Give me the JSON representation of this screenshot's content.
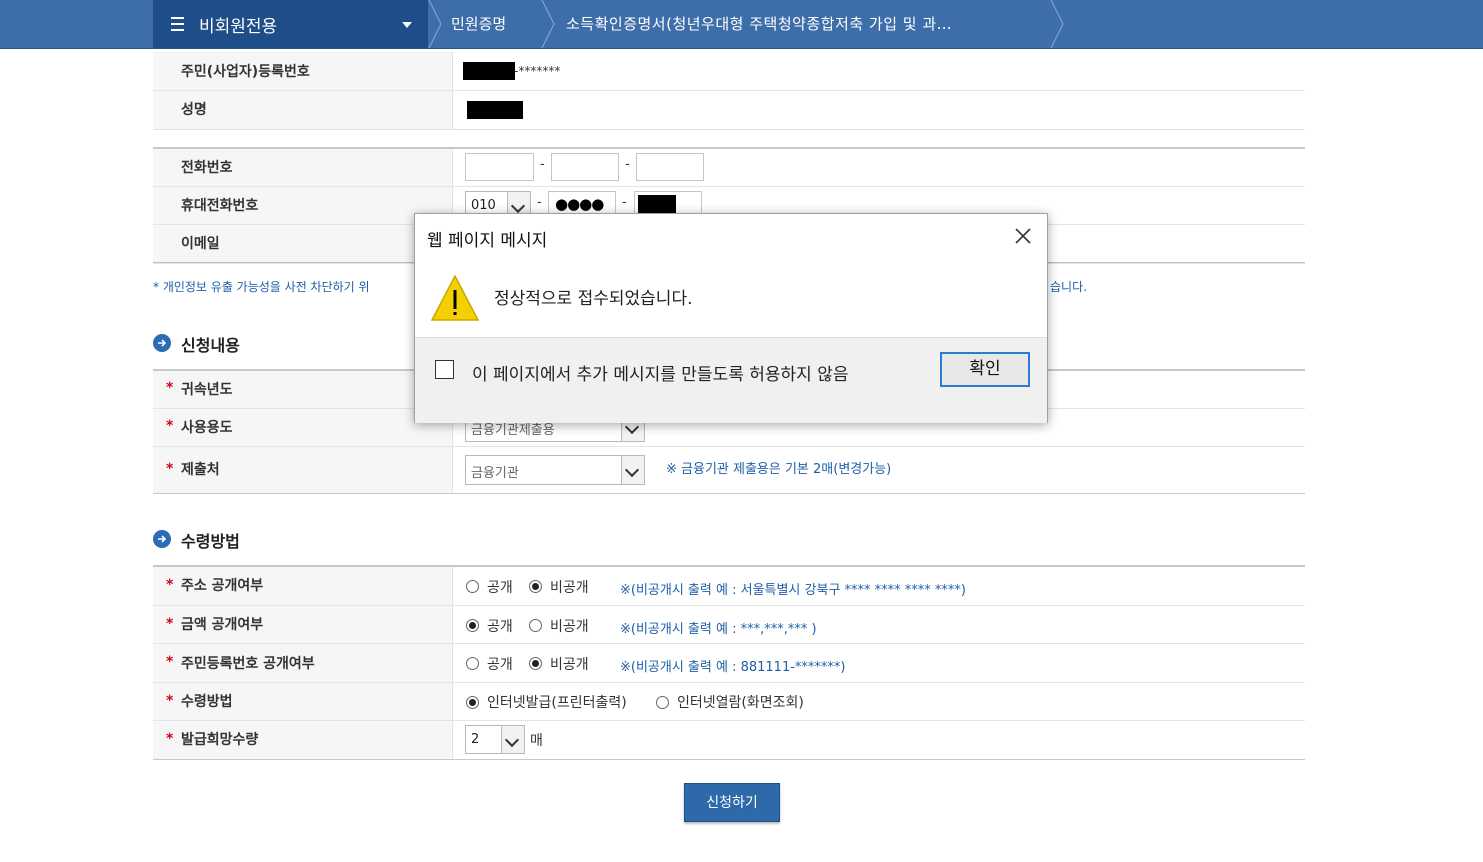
{
  "nav": {
    "menu_title": "비회원전용",
    "crumb1": "민원증명",
    "crumb2": "소득확인증명서(청년우대형 주택청약종합저축 가입 및 과…"
  },
  "personal": {
    "id_label": "주민(사업자)등록번호",
    "id_mask_suffix": "-*******",
    "name_label": "성명"
  },
  "contact": {
    "phone_label": "전화번호",
    "mobile_label": "휴대전화번호",
    "mobile_prefix": "010",
    "mobile_mid": "●●●●",
    "email_label": "이메일",
    "dash": "-",
    "notice_left": "* 개인정보 유출 가능성을 사전 차단하기 위",
    "notice_right": "습니다."
  },
  "apply": {
    "section_title": "신청내용",
    "year_label": "귀속년도",
    "usage_label": "사용용도",
    "usage_value": "금융기관제출용",
    "submit_to_label": "제출처",
    "submit_to_value": "금융기관",
    "submit_to_note": "※ 금융기관 제출용은 기본 2매(변경가능)"
  },
  "receive": {
    "section_title": "수령방법",
    "addr_label": "주소 공개여부",
    "amount_label": "금액 공개여부",
    "rrn_label": "주민등록번호 공개여부",
    "method_label": "수령방법",
    "qty_label": "발급희망수량",
    "public": "공개",
    "private": "비공개",
    "addr_note": "※(비공개시 출력 예 : 서울특별시 강북구 **** **** **** ****)",
    "amount_note": "※(비공개시 출력 예 : ***,***,*** )",
    "rrn_note": "※(비공개시 출력 예 : 881111-*******)",
    "method_internet_print": "인터넷발급(프린터출력)",
    "method_internet_view": "인터넷열람(화면조회)",
    "qty_value": "2",
    "qty_unit": "매"
  },
  "submit_label": "신청하기",
  "dialog": {
    "title": "웹 페이지 메시지",
    "message": "정상적으로 접수되었습니다.",
    "checkbox_label": "이 페이지에서 추가 메시지를 만들도록 허용하지 않음",
    "ok_label": "확인"
  },
  "colors": {
    "nav_bg": "#3e6eaa",
    "nav_dark": "#1f4d8a",
    "accent_blue": "#1f5fa8",
    "required_star": "#d0021b"
  }
}
